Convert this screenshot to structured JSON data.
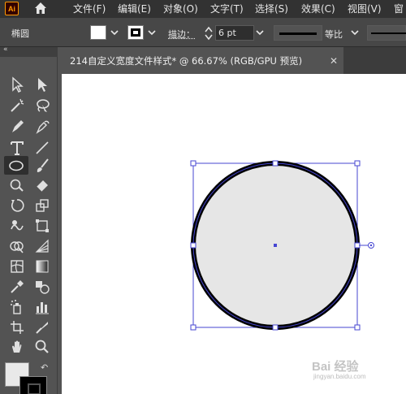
{
  "app": {
    "logo": "Ai"
  },
  "menu": [
    "文件(F)",
    "编辑(E)",
    "对象(O)",
    "文字(T)",
    "选择(S)",
    "效果(C)",
    "视图(V)",
    "窗"
  ],
  "control_bar": {
    "shape_name": "椭圆",
    "stroke_label": "描边：",
    "stroke_weight": "6 pt",
    "profile_label": "等比"
  },
  "document_tab": {
    "title": "214自定义宽度文件样式* @ 66.67% (RGB/GPU 预览)",
    "close": "✕"
  },
  "toolbar": {
    "collapse": "«",
    "tools": [
      "selection-tool",
      "direct-selection-tool",
      "magic-wand-tool",
      "lasso-tool",
      "pen-tool",
      "curvature-tool",
      "type-tool",
      "line-segment-tool",
      "ellipse-tool",
      "paintbrush-tool",
      "shaper-tool",
      "eraser-tool",
      "rotate-tool",
      "scale-tool",
      "warp-tool",
      "free-transform-tool",
      "shape-builder-tool",
      "perspective-grid-tool",
      "mesh-tool",
      "gradient-tool",
      "eyedropper-tool",
      "blend-tool",
      "symbol-sprayer-tool",
      "column-graph-tool",
      "artboard-tool",
      "slice-tool",
      "hand-tool",
      "zoom-tool"
    ],
    "active_tool": "ellipse-tool",
    "swap_arrow": "↶"
  },
  "colors": {
    "fill": "#e6e6e6",
    "stroke": "#000000",
    "selection": "#4646d2"
  },
  "watermark": {
    "main": "Bai 经验",
    "sub": "jingyan.baidu.com"
  }
}
